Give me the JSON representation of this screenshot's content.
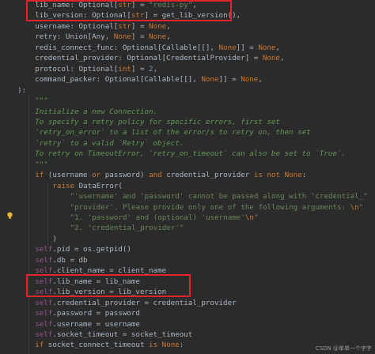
{
  "code_lines": [
    {
      "indent": 4,
      "tokens": [
        {
          "t": "lib_name: Optional[",
          "c": ""
        },
        {
          "t": "str",
          "c": "kw"
        },
        {
          "t": "] = ",
          "c": ""
        },
        {
          "t": "\"redis-py\"",
          "c": "str"
        },
        {
          "t": ",",
          "c": ""
        }
      ]
    },
    {
      "indent": 4,
      "tokens": [
        {
          "t": "lib_version: Optional[",
          "c": ""
        },
        {
          "t": "str",
          "c": "kw"
        },
        {
          "t": "] = get_lib_version(),",
          "c": ""
        }
      ]
    },
    {
      "indent": 4,
      "tokens": [
        {
          "t": "username: Optional[",
          "c": ""
        },
        {
          "t": "str",
          "c": "kw"
        },
        {
          "t": "] = ",
          "c": ""
        },
        {
          "t": "None",
          "c": "kw"
        },
        {
          "t": ",",
          "c": ""
        }
      ]
    },
    {
      "indent": 4,
      "tokens": [
        {
          "t": "retry: Union[Any, ",
          "c": ""
        },
        {
          "t": "None",
          "c": "kw"
        },
        {
          "t": "] = ",
          "c": ""
        },
        {
          "t": "None",
          "c": "kw"
        },
        {
          "t": ",",
          "c": ""
        }
      ]
    },
    {
      "indent": 4,
      "tokens": [
        {
          "t": "redis_connect_func: Optional[Callable[[], ",
          "c": ""
        },
        {
          "t": "None",
          "c": "kw"
        },
        {
          "t": "]] = ",
          "c": ""
        },
        {
          "t": "None",
          "c": "kw"
        },
        {
          "t": ",",
          "c": ""
        }
      ]
    },
    {
      "indent": 4,
      "tokens": [
        {
          "t": "credential_provider: Optional[CredentialProvider] = ",
          "c": ""
        },
        {
          "t": "None",
          "c": "kw"
        },
        {
          "t": ",",
          "c": ""
        }
      ]
    },
    {
      "indent": 4,
      "tokens": [
        {
          "t": "protocol: Optional[",
          "c": ""
        },
        {
          "t": "int",
          "c": "kw"
        },
        {
          "t": "] = ",
          "c": ""
        },
        {
          "t": "2",
          "c": "num"
        },
        {
          "t": ",",
          "c": ""
        }
      ]
    },
    {
      "indent": 4,
      "tokens": [
        {
          "t": "command_packer: Optional[Callable[[], ",
          "c": ""
        },
        {
          "t": "None",
          "c": "kw"
        },
        {
          "t": "]] = ",
          "c": ""
        },
        {
          "t": "None",
          "c": "kw"
        },
        {
          "t": ",",
          "c": ""
        }
      ]
    },
    {
      "indent": 0,
      "tokens": [
        {
          "t": "):",
          "c": ""
        }
      ]
    },
    {
      "indent": 4,
      "tokens": [
        {
          "t": "\"\"\"",
          "c": "doc"
        }
      ]
    },
    {
      "indent": 4,
      "tokens": [
        {
          "t": "Initialize a new Connection.",
          "c": "doc"
        }
      ]
    },
    {
      "indent": 4,
      "tokens": [
        {
          "t": "To specify a retry policy for specific errors, first set",
          "c": "doc"
        }
      ]
    },
    {
      "indent": 4,
      "tokens": [
        {
          "t": "`retry_on_error` to a list of the error/s to retry on, then set",
          "c": "doc"
        }
      ]
    },
    {
      "indent": 4,
      "tokens": [
        {
          "t": "`retry` to a valid `Retry` object.",
          "c": "doc"
        }
      ]
    },
    {
      "indent": 4,
      "tokens": [
        {
          "t": "To retry on TimeoutError, `retry_on_timeout` can also be set to `True`.",
          "c": "doc"
        }
      ]
    },
    {
      "indent": 4,
      "tokens": [
        {
          "t": "\"\"\"",
          "c": "doc"
        }
      ]
    },
    {
      "indent": 4,
      "tokens": [
        {
          "t": "if",
          "c": "kw"
        },
        {
          "t": " (username ",
          "c": ""
        },
        {
          "t": "or",
          "c": "kw"
        },
        {
          "t": " password) ",
          "c": ""
        },
        {
          "t": "and",
          "c": "kw"
        },
        {
          "t": " credential_provider ",
          "c": ""
        },
        {
          "t": "is not",
          "c": "kw"
        },
        {
          "t": " ",
          "c": ""
        },
        {
          "t": "None",
          "c": "kw"
        },
        {
          "t": ":",
          "c": ""
        }
      ]
    },
    {
      "indent": 8,
      "tokens": [
        {
          "t": "raise",
          "c": "kw"
        },
        {
          "t": " DataError(",
          "c": ""
        }
      ]
    },
    {
      "indent": 12,
      "tokens": [
        {
          "t": "\"'username' and 'password' cannot be passed along with 'credential_\"",
          "c": "str"
        }
      ]
    },
    {
      "indent": 12,
      "tokens": [
        {
          "t": "\"provider'. Please provide only one of the following arguments: ",
          "c": "str"
        },
        {
          "t": "\\n",
          "c": "esc"
        },
        {
          "t": "\"",
          "c": "str"
        }
      ]
    },
    {
      "indent": 12,
      "tokens": [
        {
          "t": "\"1. 'password' and (optional) 'username'",
          "c": "str"
        },
        {
          "t": "\\n",
          "c": "esc"
        },
        {
          "t": "\"",
          "c": "str"
        }
      ]
    },
    {
      "indent": 12,
      "tokens": [
        {
          "t": "\"2. 'credential_provider'\"",
          "c": "str"
        }
      ]
    },
    {
      "indent": 8,
      "tokens": [
        {
          "t": ")",
          "c": ""
        }
      ]
    },
    {
      "indent": 4,
      "tokens": [
        {
          "t": "self",
          "c": "self"
        },
        {
          "t": ".pid = os.getpid()",
          "c": ""
        }
      ]
    },
    {
      "indent": 4,
      "tokens": [
        {
          "t": "self",
          "c": "self"
        },
        {
          "t": ".db = db",
          "c": ""
        }
      ]
    },
    {
      "indent": 4,
      "tokens": [
        {
          "t": "self",
          "c": "self"
        },
        {
          "t": ".client_name = client_name",
          "c": ""
        }
      ]
    },
    {
      "indent": 4,
      "tokens": [
        {
          "t": "self",
          "c": "self"
        },
        {
          "t": ".lib_name = lib_name",
          "c": ""
        }
      ]
    },
    {
      "indent": 4,
      "tokens": [
        {
          "t": "self",
          "c": "self"
        },
        {
          "t": ".lib_version = lib_version",
          "c": ""
        }
      ]
    },
    {
      "indent": 4,
      "tokens": [
        {
          "t": "self",
          "c": "self"
        },
        {
          "t": ".credential_provider = credential_provider",
          "c": ""
        }
      ]
    },
    {
      "indent": 4,
      "tokens": [
        {
          "t": "self",
          "c": "self"
        },
        {
          "t": ".password = password",
          "c": ""
        }
      ]
    },
    {
      "indent": 4,
      "tokens": [
        {
          "t": "self",
          "c": "self"
        },
        {
          "t": ".username = username",
          "c": ""
        }
      ]
    },
    {
      "indent": 4,
      "tokens": [
        {
          "t": "self",
          "c": "self"
        },
        {
          "t": ".socket_timeout = socket_timeout",
          "c": ""
        }
      ]
    },
    {
      "indent": 4,
      "tokens": [
        {
          "t": "if",
          "c": "kw"
        },
        {
          "t": " socket_connect_timeout ",
          "c": ""
        },
        {
          "t": "is",
          "c": "kw"
        },
        {
          "t": " ",
          "c": ""
        },
        {
          "t": "None",
          "c": "kw"
        },
        {
          "t": ":",
          "c": ""
        }
      ]
    }
  ],
  "watermark": "CSDN @单单一个字字",
  "colors": {
    "background": "#2b2b2b",
    "keyword": "#cc7832",
    "string": "#6a8759",
    "number": "#6897bb",
    "self": "#94558d",
    "docstring": "#629755",
    "highlight_box": "#e0242a"
  },
  "icons": [
    "lightbulb-icon"
  ]
}
